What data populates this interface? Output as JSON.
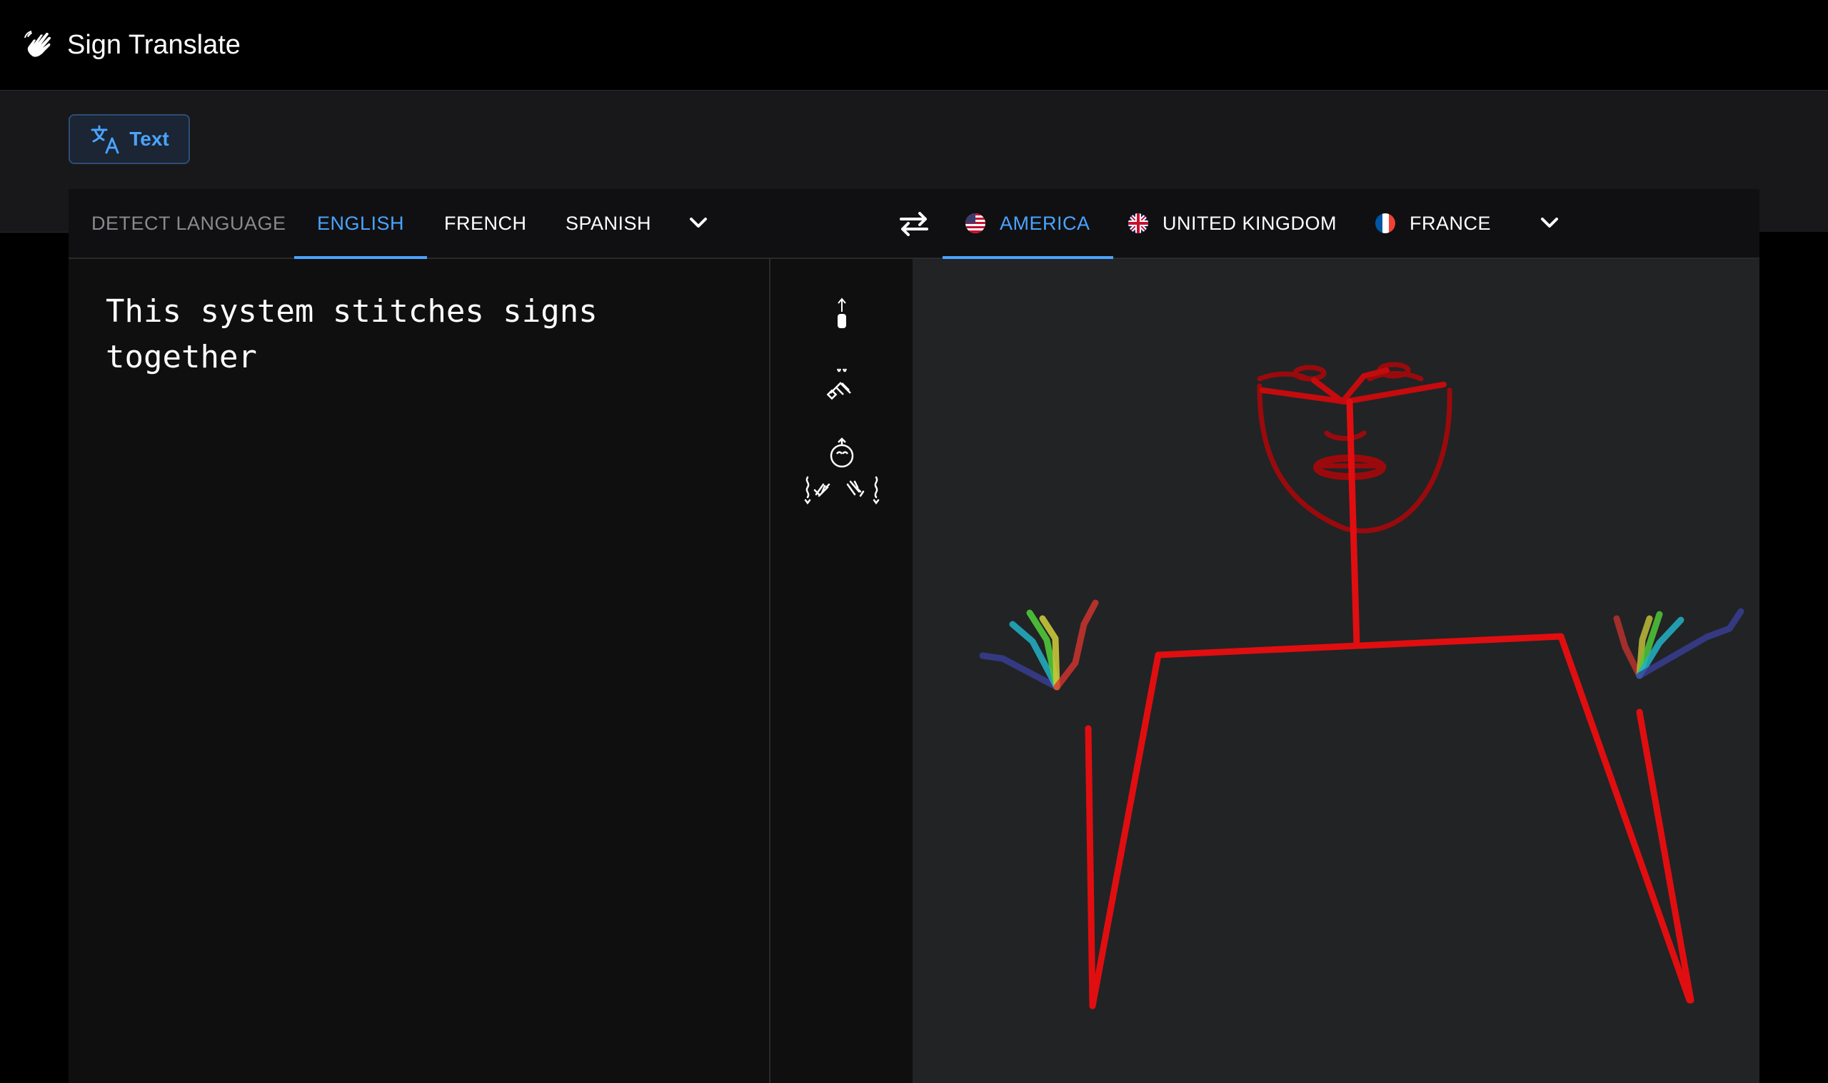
{
  "header": {
    "app_title": "Sign Translate",
    "logo_icon": "waving-hands-icon"
  },
  "mode": {
    "text_label": "Text",
    "icon": "translate-icon"
  },
  "source_languages": {
    "items": [
      {
        "label": "DETECT LANGUAGE",
        "state": "muted"
      },
      {
        "label": "ENGLISH",
        "state": "active"
      },
      {
        "label": "FRENCH",
        "state": "normal"
      },
      {
        "label": "SPANISH",
        "state": "normal"
      }
    ],
    "more_icon": "chevron-down-icon"
  },
  "swap_icon": "swap-arrows-icon",
  "target_languages": {
    "items": [
      {
        "label": "AMERICA",
        "flag": "us-flag-icon",
        "state": "active"
      },
      {
        "label": "UNITED KINGDOM",
        "flag": "uk-flag-icon",
        "state": "normal"
      },
      {
        "label": "FRANCE",
        "flag": "fr-flag-icon",
        "state": "normal"
      }
    ],
    "more_icon": "chevron-down-icon"
  },
  "input": {
    "text": "This system stitches signs together"
  },
  "signwriting_icons": [
    "signwriting-sign-1-icon",
    "signwriting-sign-2-icon",
    "signwriting-sign-3-icon",
    "signwriting-sign-4-icon"
  ],
  "colors": {
    "accent": "#4aa3ff",
    "pose_body": "#e00e10",
    "pose_face": "#9a0a0c",
    "hand_thumb": "#3a3f99",
    "hand_index": "#21b3c6",
    "hand_middle": "#4fc93a",
    "hand_ring": "#c9c63a",
    "hand_pinky": "#d8342e"
  }
}
